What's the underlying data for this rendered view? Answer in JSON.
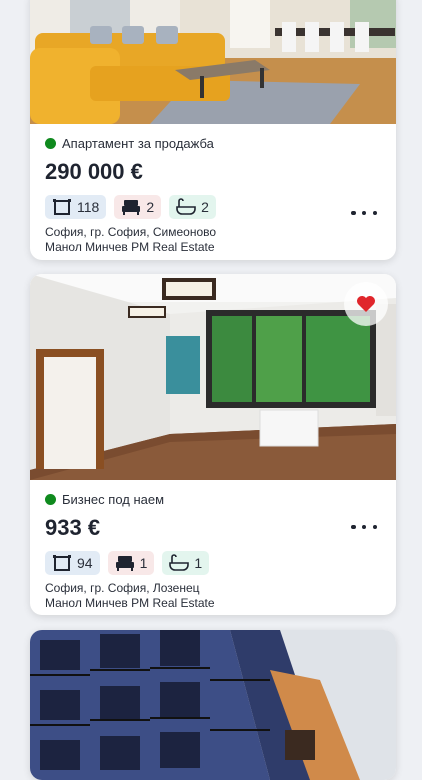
{
  "listings": [
    {
      "type_label": "Апартамент за продажба",
      "status_color": "#0f8a1e",
      "price": "290 000 €",
      "area": "118",
      "bedrooms": "2",
      "bathrooms": "2",
      "address": "София, гр. София, Симеоново",
      "agency": "Манол Минчев PM Real Estate",
      "favorited": false
    },
    {
      "type_label": "Бизнес под наем",
      "status_color": "#0f8a1e",
      "price": "933 €",
      "area": "94",
      "bedrooms": "1",
      "bathrooms": "1",
      "address": "София, гр. София, Лозенец",
      "agency": "Манол Минчев PM Real Estate",
      "favorited": true,
      "favorite_icon": "heart-icon",
      "favorite_color": "#e0262b"
    },
    {
      "photo_only": true
    }
  ],
  "icons": {
    "area": "floor-plan-icon",
    "bedrooms": "bed-icon",
    "bathrooms": "bathtub-icon",
    "more": "more-horizontal-icon"
  }
}
